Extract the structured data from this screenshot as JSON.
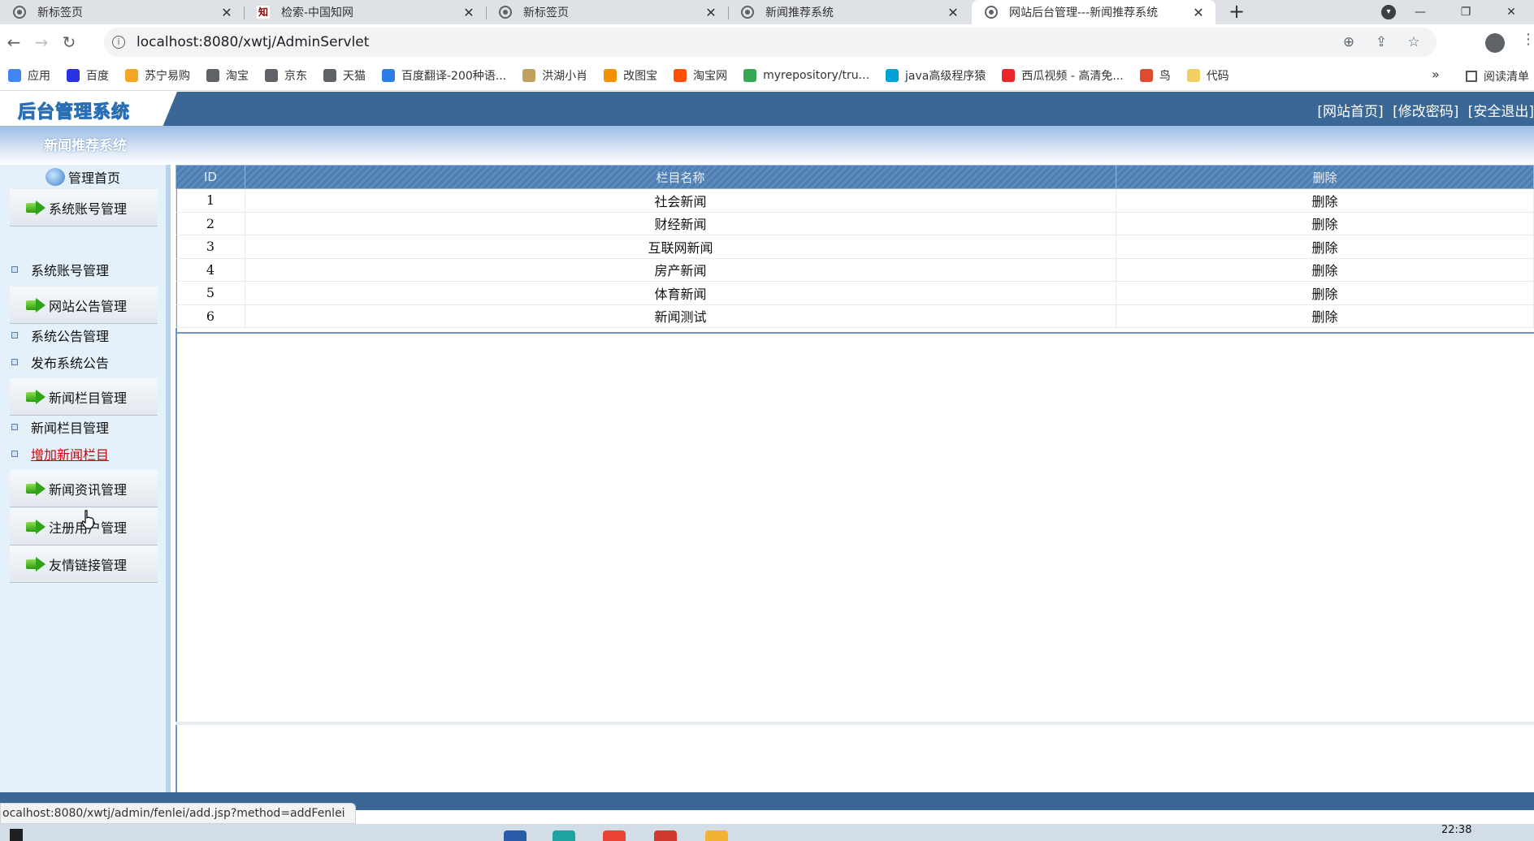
{
  "browser": {
    "tabs": [
      {
        "title": "新标签页",
        "favicon": "chrome-icon"
      },
      {
        "title": "检索-中国知网",
        "favicon": "cnki-icon"
      },
      {
        "title": "新标签页",
        "favicon": "chrome-icon"
      },
      {
        "title": "新闻推荐系统",
        "favicon": "chrome-icon"
      },
      {
        "title": "网站后台管理---新闻推荐系统",
        "favicon": "chrome-icon"
      }
    ],
    "new_tab": "+",
    "url": "localhost:8080/xwtj/AdminServlet",
    "bookmarks": [
      {
        "label": "应用",
        "icon": "apps-grid-icon",
        "color": "#4285f4"
      },
      {
        "label": "百度",
        "icon": "baidu-paw-icon",
        "color": "#2932e1"
      },
      {
        "label": "苏宁易购",
        "icon": "suning-icon",
        "color": "#f5a623"
      },
      {
        "label": "淘宝",
        "icon": "globe-icon",
        "color": "#5f6368"
      },
      {
        "label": "京东",
        "icon": "globe-icon",
        "color": "#5f6368"
      },
      {
        "label": "天猫",
        "icon": "globe-icon",
        "color": "#5f6368"
      },
      {
        "label": "百度翻译-200种语...",
        "icon": "translate-icon",
        "color": "#2b7de9"
      },
      {
        "label": "洪湖小肖",
        "icon": "pen-icon",
        "color": "#c0a060"
      },
      {
        "label": "改图宝",
        "icon": "gaitubao-icon",
        "color": "#f29100"
      },
      {
        "label": "淘宝网",
        "icon": "taobao-icon",
        "color": "#ff5000"
      },
      {
        "label": "myrepository/tru...",
        "icon": "chrome-color-icon",
        "color": "#34a853"
      },
      {
        "label": "java高级程序猿",
        "icon": "bilibili-icon",
        "color": "#00a1d6"
      },
      {
        "label": "西瓜视频 - 高清免...",
        "icon": "xigua-icon",
        "color": "#e8262a"
      },
      {
        "label": "鸟",
        "icon": "bird-icon",
        "color": "#e04a2f"
      },
      {
        "label": "代码",
        "icon": "moon-icon",
        "color": "#f0d060"
      }
    ],
    "bookmarks_more": "»",
    "reading_list": "阅读清单",
    "status_url": "ocalhost:8080/xwtj/admin/fenlei/add.jsp?method=addFenlei"
  },
  "admin": {
    "logo": "后台管理系统",
    "header_links": [
      "[网站首页]",
      "[修改密码]",
      "[安全退出]"
    ],
    "system_name": "新闻推荐系统",
    "home": "管理首页",
    "menu": [
      {
        "title": "系统账号管理",
        "items": [
          "系统账号管理"
        ]
      },
      {
        "title": "网站公告管理",
        "items": [
          "系统公告管理",
          "发布系统公告"
        ]
      },
      {
        "title": "新闻栏目管理",
        "items": [
          "新闻栏目管理",
          "增加新闻栏目"
        ]
      },
      {
        "title": "新闻资讯管理",
        "items": []
      },
      {
        "title": "注册用户管理",
        "items": []
      },
      {
        "title": "友情链接管理",
        "items": []
      }
    ],
    "active_item": "增加新闻栏目"
  },
  "table": {
    "headers": [
      "ID",
      "栏目名称",
      "删除"
    ],
    "rows": [
      {
        "id": "1",
        "name": "社会新闻",
        "action": "删除"
      },
      {
        "id": "2",
        "name": "财经新闻",
        "action": "删除"
      },
      {
        "id": "3",
        "name": "互联网新闻",
        "action": "删除"
      },
      {
        "id": "4",
        "name": "房产新闻",
        "action": "删除"
      },
      {
        "id": "5",
        "name": "体育新闻",
        "action": "删除"
      },
      {
        "id": "6",
        "name": "新闻测试",
        "action": "删除"
      }
    ]
  },
  "taskbar": {
    "clock": "22:38"
  },
  "colors": {
    "header_blue": "#3b6796",
    "sidebar_bg": "#e4f1fb",
    "active_link": "#cc0000"
  }
}
